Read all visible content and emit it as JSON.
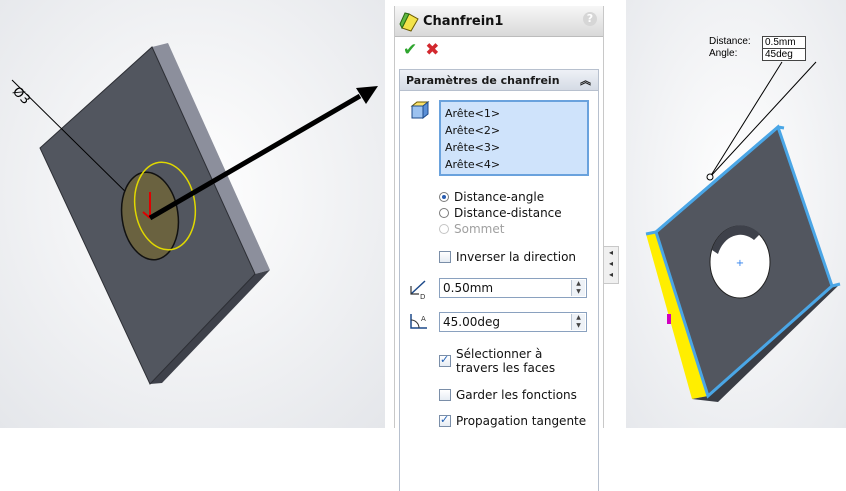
{
  "left_view": {
    "dimension_label": "Ø3"
  },
  "panel": {
    "title": "Chanfrein1",
    "help": "?",
    "ok_icon": "✔",
    "cancel_icon": "✖",
    "section_title": "Paramètres de chanfrein",
    "collapse_icon": "double-chevron-up-icon",
    "edges": [
      "Arête<1>",
      "Arête<2>",
      "Arête<3>",
      "Arête<4>"
    ],
    "options": {
      "distance_angle": "Distance-angle",
      "distance_distance": "Distance-distance",
      "sommet": "Sommet"
    },
    "selected_option": "Distance-angle",
    "inverse_direction": "Inverser la direction",
    "distance_value": "0.50mm",
    "angle_value": "45.00deg",
    "select_through_faces": "Sélectionner à travers les faces",
    "keep_features": "Garder les fonctions",
    "tangent_propagation": "Propagation tangente"
  },
  "right_view": {
    "distance_label": "Distance:",
    "distance_value": "0.5mm",
    "angle_label": "Angle:",
    "angle_value": "45deg"
  },
  "colors": {
    "part_face": "#52565f",
    "part_edge_highlight": "#4aa6e6",
    "chamfer_face": "#ffee00",
    "selection_bg": "#cfe3fb"
  }
}
